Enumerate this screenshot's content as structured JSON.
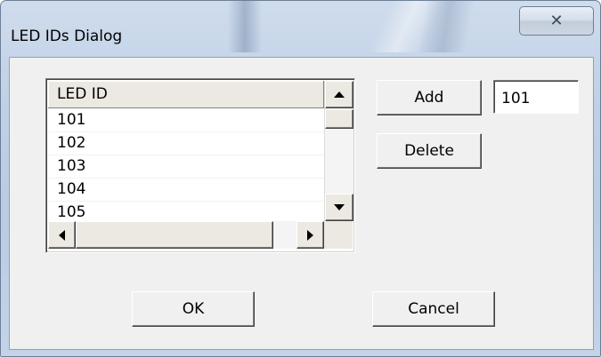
{
  "window": {
    "title": "LED IDs Dialog",
    "close_glyph": "✕"
  },
  "list": {
    "column_header": "LED ID",
    "rows": [
      "101",
      "102",
      "103",
      "104",
      "105"
    ]
  },
  "buttons": {
    "add": "Add",
    "delete": "Delete",
    "ok": "OK",
    "cancel": "Cancel"
  },
  "id_field": {
    "value": "101"
  },
  "colors": {
    "client_bg": "#f0f0f0",
    "frame_blue": "#bfd0e6"
  }
}
